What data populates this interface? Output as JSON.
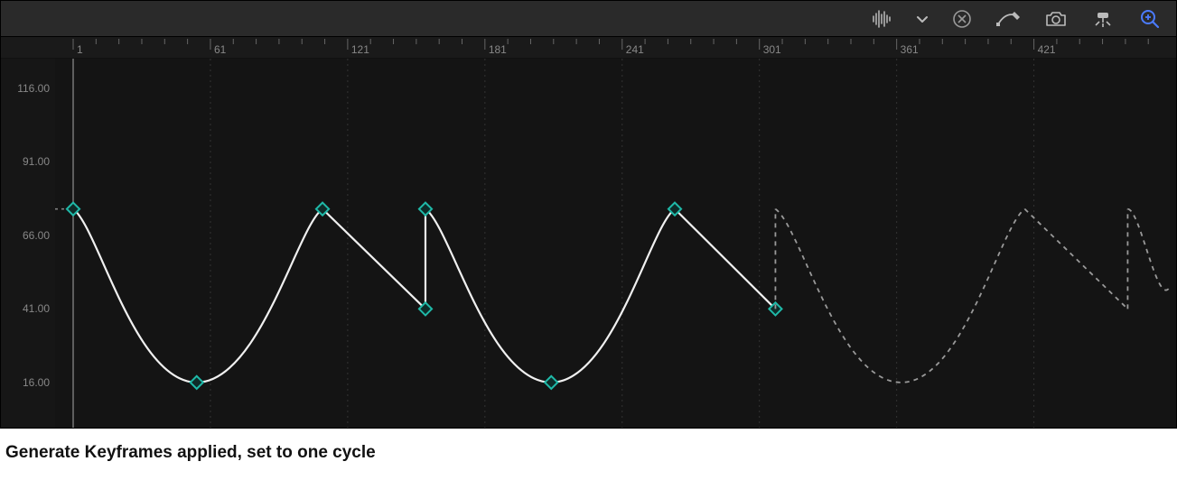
{
  "caption": "Generate Keyframes applied, set to one cycle",
  "toolbar": {
    "audio_icon": "audio-waveform-icon",
    "menu_icon": "chevron-down-icon",
    "clear_icon": "clear-circle-icon",
    "curve_icon": "curve-edit-icon",
    "camera_icon": "camera-icon",
    "snap_icon": "snap-icon",
    "zoom_icon": "zoom-icon"
  },
  "timeline": {
    "major_ticks": [
      "1",
      "61",
      "121",
      "181",
      "241",
      "301",
      "361",
      "421"
    ]
  },
  "yaxis": {
    "labels": [
      "116.00",
      "91.00",
      "66.00",
      "41.00",
      "16.00"
    ]
  },
  "chart_data": {
    "type": "line",
    "xlabel": "",
    "ylabel": "",
    "xlim": [
      1,
      480
    ],
    "ylim": [
      0,
      120
    ],
    "x_ticks": [
      1,
      61,
      121,
      181,
      241,
      301,
      361,
      421
    ],
    "y_ticks": [
      16,
      41,
      66,
      91,
      116
    ],
    "series": [
      {
        "name": "active-curve",
        "style": "solid",
        "segments": [
          {
            "type": "smooth",
            "points": [
              [
                1,
                75
              ],
              [
                55,
                16
              ],
              [
                110,
                75
              ]
            ]
          },
          {
            "type": "linear",
            "points": [
              [
                110,
                75
              ],
              [
                155,
                41
              ]
            ]
          },
          {
            "type": "jump",
            "from": [
              155,
              41
            ],
            "to": [
              155,
              75
            ]
          },
          {
            "type": "smooth",
            "points": [
              [
                155,
                75
              ],
              [
                210,
                16
              ],
              [
                264,
                75
              ]
            ]
          },
          {
            "type": "linear",
            "points": [
              [
                264,
                75
              ],
              [
                308,
                41
              ]
            ]
          }
        ],
        "keyframes": [
          [
            1,
            75
          ],
          [
            55,
            16
          ],
          [
            110,
            75
          ],
          [
            155,
            41
          ],
          [
            155,
            75
          ],
          [
            210,
            16
          ],
          [
            264,
            75
          ],
          [
            308,
            41
          ]
        ]
      },
      {
        "name": "extrapolated-cycle",
        "style": "dashed",
        "segments": [
          {
            "type": "jump",
            "from": [
              308,
              41
            ],
            "to": [
              308,
              75
            ]
          },
          {
            "type": "smooth",
            "points": [
              [
                308,
                75
              ],
              [
                363,
                16
              ],
              [
                417,
                75
              ]
            ]
          },
          {
            "type": "linear",
            "points": [
              [
                417,
                75
              ],
              [
                462,
                41
              ]
            ]
          },
          {
            "type": "jump",
            "from": [
              462,
              41
            ],
            "to": [
              462,
              75
            ]
          },
          {
            "type": "smooth_partial",
            "points": [
              [
                462,
                75
              ],
              [
                480,
                48
              ]
            ]
          }
        ]
      }
    ],
    "reference_line": {
      "y": 75,
      "style": "dashed",
      "extent": "left-of-origin"
    },
    "colors": {
      "curve": "#f0f0f0",
      "dashed": "#999999",
      "keyframe": "#1fb9a8",
      "accent_zoom": "#4b7bff"
    }
  }
}
